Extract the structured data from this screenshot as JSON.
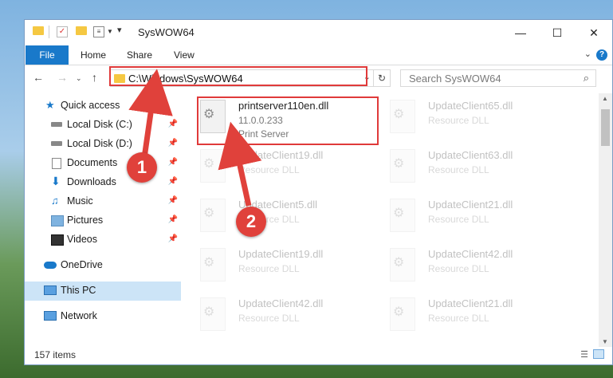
{
  "window": {
    "title": "SysWOW64",
    "controls": {
      "minimize": "—",
      "maximize": "☐",
      "close": "✕"
    }
  },
  "ribbon": {
    "tabs": [
      "File",
      "Home",
      "Share",
      "View"
    ],
    "help": "?"
  },
  "address": {
    "path": "C:\\Windows\\SysWOW64",
    "search_placeholder": "Search SysWOW64"
  },
  "nav": {
    "items": [
      {
        "label": "Quick access",
        "icon": "star-icon"
      },
      {
        "label": "Local Disk (C:)",
        "icon": "drive-icon",
        "pinned": true
      },
      {
        "label": "Local Disk (D:)",
        "icon": "drive-icon",
        "pinned": true
      },
      {
        "label": "Documents",
        "icon": "documents-icon",
        "pinned": true
      },
      {
        "label": "Downloads",
        "icon": "downloads-icon",
        "pinned": true
      },
      {
        "label": "Music",
        "icon": "music-icon",
        "pinned": true
      },
      {
        "label": "Pictures",
        "icon": "pictures-icon",
        "pinned": true
      },
      {
        "label": "Videos",
        "icon": "videos-icon",
        "pinned": true
      },
      {
        "label": "OneDrive",
        "icon": "cloud-icon"
      },
      {
        "label": "This PC",
        "icon": "pc-icon",
        "selected": true
      },
      {
        "label": "Network",
        "icon": "network-icon"
      }
    ]
  },
  "files": {
    "left": [
      {
        "name": "printserver110en.dll",
        "line2": "11.0.0.233",
        "line3": "Print Server"
      },
      {
        "name": "UpdateClient19.dll",
        "line2": "Resource DLL"
      },
      {
        "name": "UpdateClient5.dll",
        "line2": "Resource DLL"
      },
      {
        "name": "UpdateClient19.dll",
        "line2": "Resource DLL"
      },
      {
        "name": "UpdateClient42.dll",
        "line2": "Resource DLL"
      }
    ],
    "right": [
      {
        "name": "UpdateClient65.dll",
        "line2": "Resource DLL"
      },
      {
        "name": "UpdateClient63.dll",
        "line2": "Resource DLL"
      },
      {
        "name": "UpdateClient21.dll",
        "line2": "Resource DLL"
      },
      {
        "name": "UpdateClient42.dll",
        "line2": "Resource DLL"
      },
      {
        "name": "UpdateClient21.dll",
        "line2": "Resource DLL"
      }
    ]
  },
  "status": {
    "count": "157 items"
  },
  "callouts": {
    "one": "1",
    "two": "2"
  },
  "colors": {
    "accent": "#1979ca",
    "highlight": "#e03a3a",
    "selection": "#cce4f7"
  }
}
